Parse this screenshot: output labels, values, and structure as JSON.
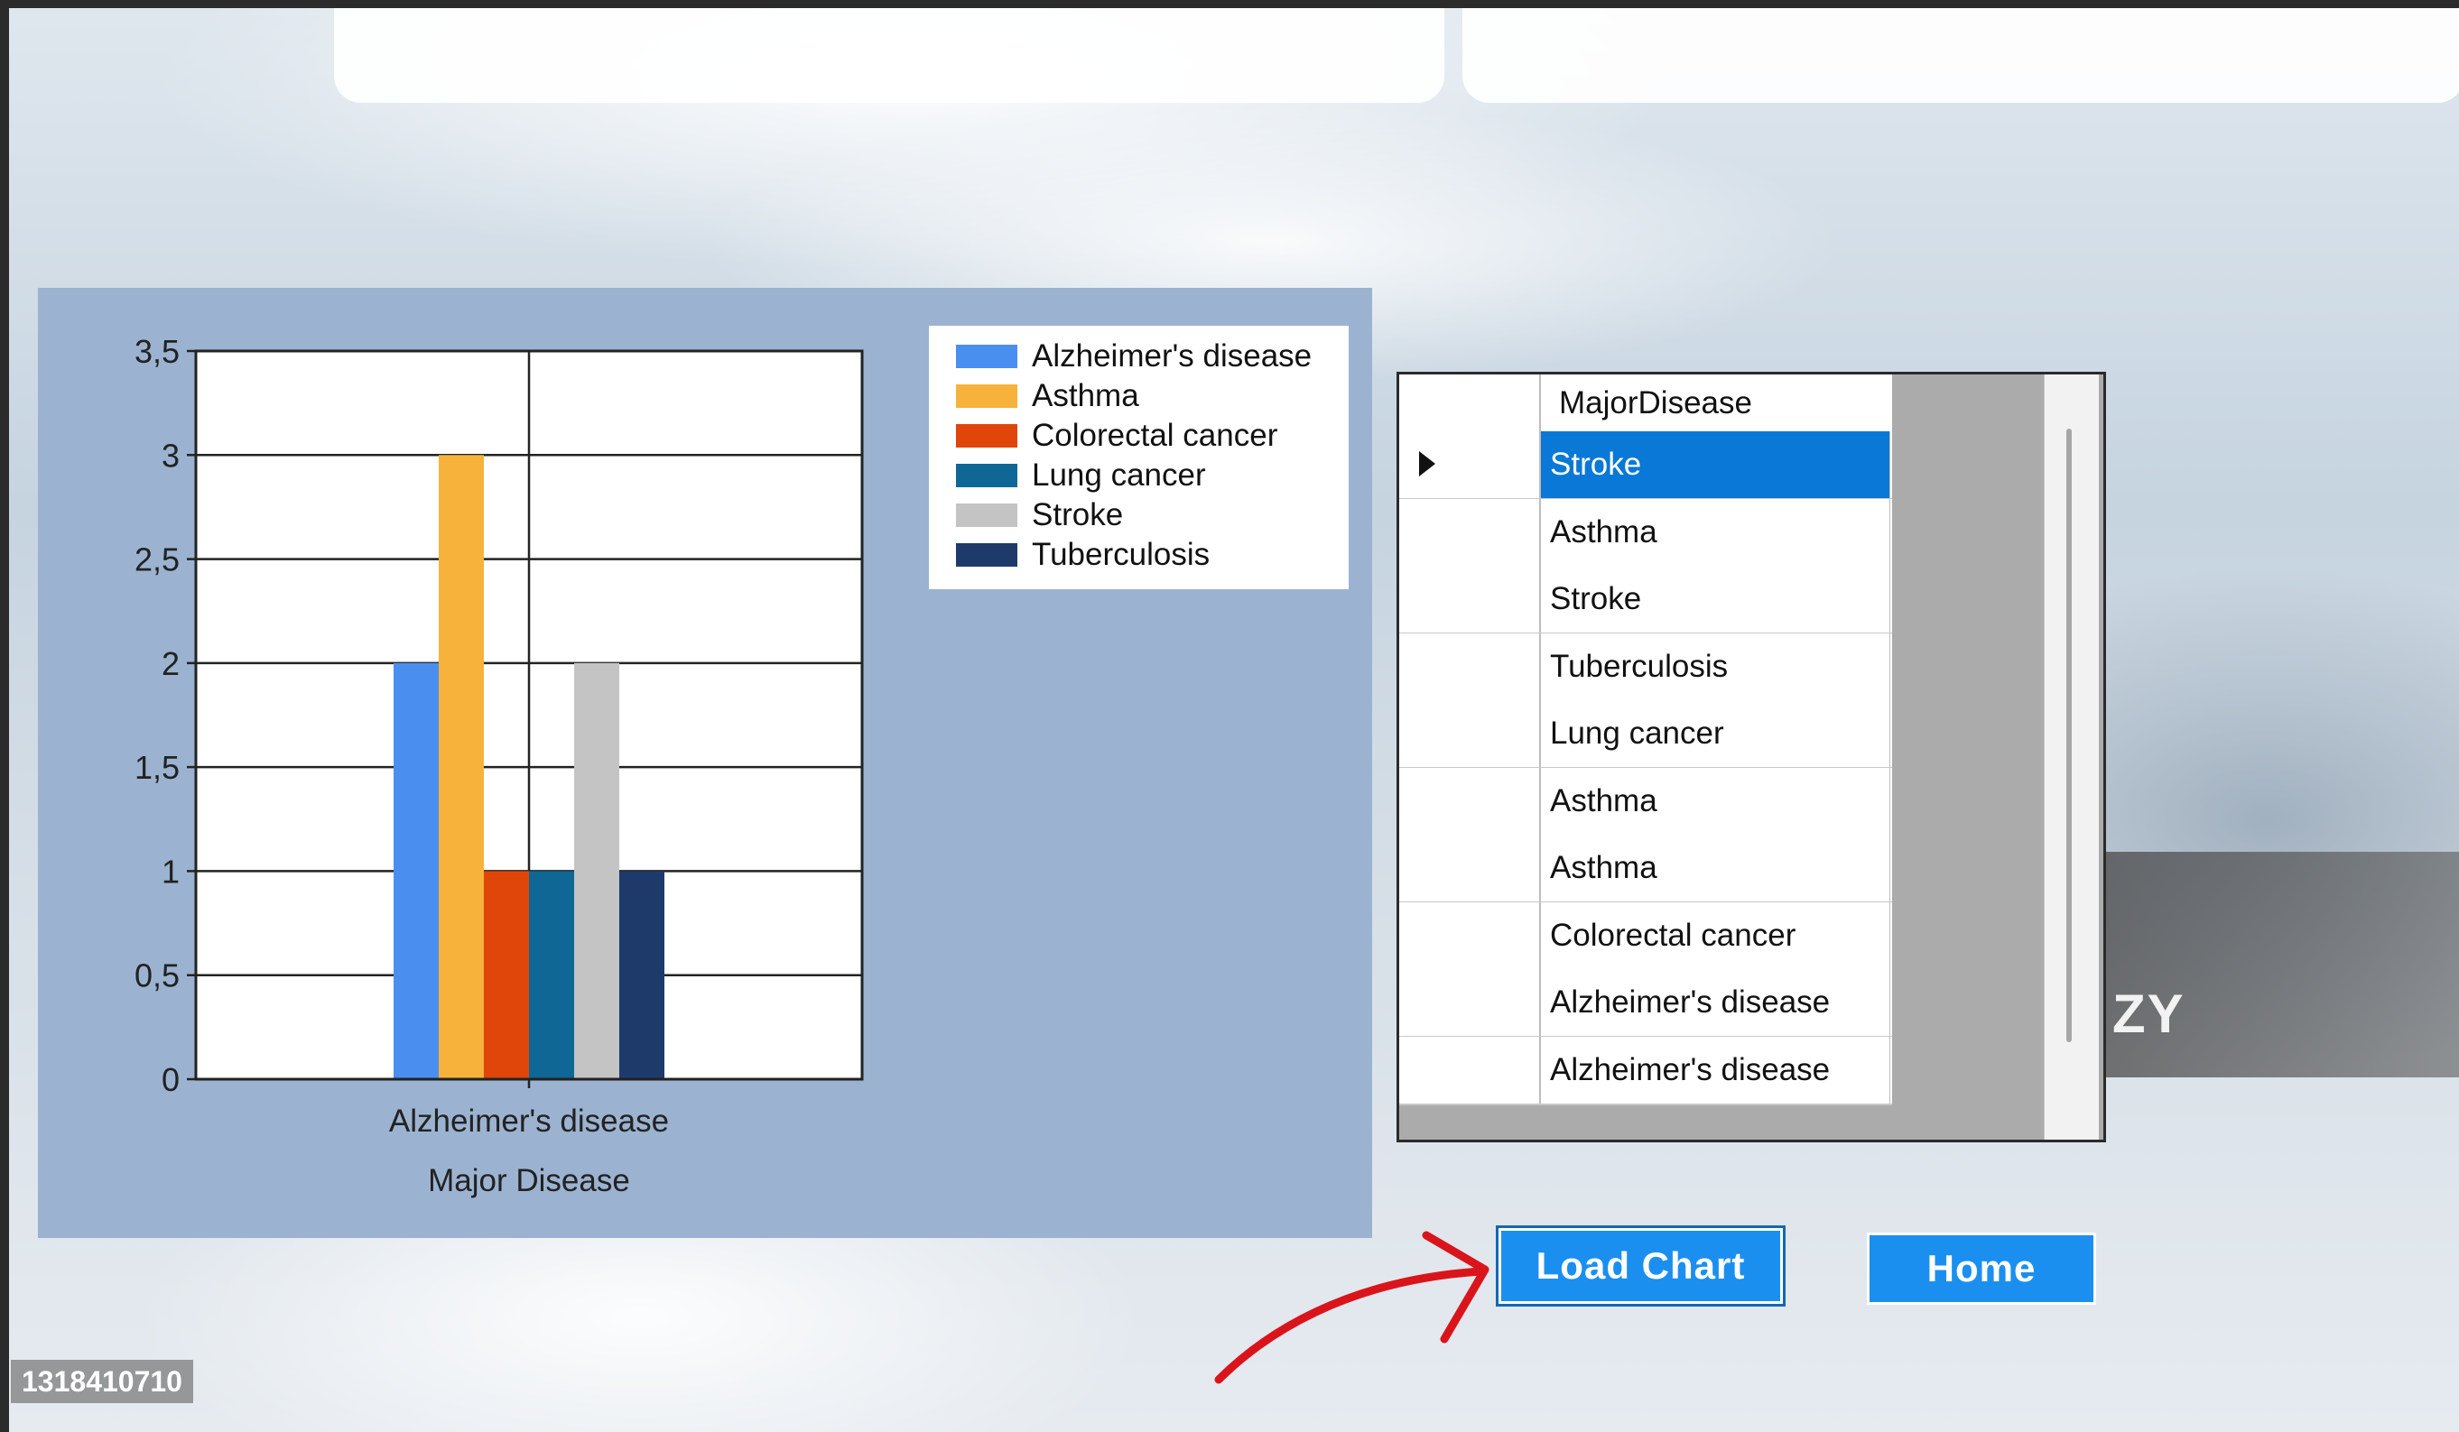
{
  "chart_data": {
    "type": "bar",
    "categories": [
      "Alzheimer's disease"
    ],
    "series": [
      {
        "name": "Alzheimer's disease",
        "values": [
          2
        ],
        "color": "#4a8ff0"
      },
      {
        "name": "Asthma",
        "values": [
          3
        ],
        "color": "#f7b23b"
      },
      {
        "name": "Colorectal cancer",
        "values": [
          1
        ],
        "color": "#e0460a"
      },
      {
        "name": "Lung cancer",
        "values": [
          1
        ],
        "color": "#0f6796"
      },
      {
        "name": "Stroke",
        "values": [
          2
        ],
        "color": "#c4c4c4"
      },
      {
        "name": "Tuberculosis",
        "values": [
          1
        ],
        "color": "#1d3a6b"
      }
    ],
    "xlabel": "Major Disease",
    "ylabel": "",
    "ylim": [
      0,
      3.5
    ],
    "yticks": [
      "0",
      "0,5",
      "1",
      "1,5",
      "2",
      "2,5",
      "3",
      "3,5"
    ],
    "legend_position": "top-right",
    "grid": true
  },
  "grid": {
    "column_header": "MajorDisease",
    "rows": [
      "Stroke",
      "Asthma",
      "Stroke",
      "Tuberculosis",
      "Lung cancer",
      "Asthma",
      "Asthma",
      "Colorectal cancer",
      "Alzheimer's disease",
      "Alzheimer's disease"
    ],
    "selected_row": 0
  },
  "buttons": {
    "load_chart": "Load Chart",
    "home": "Home"
  },
  "banner_text": "ZY",
  "watermark": "1318410710",
  "colors": {
    "button": "#1a8ff0",
    "selection": "#0a78d7",
    "chart_panel": "#9bb3d0",
    "annotation_arrow": "#d9151b"
  }
}
